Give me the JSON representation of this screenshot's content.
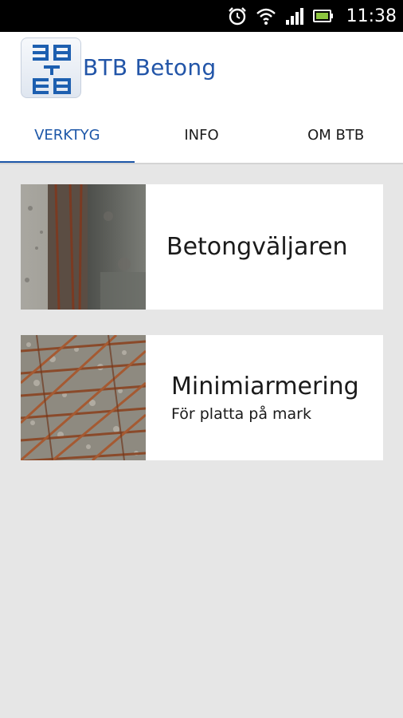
{
  "status_bar": {
    "time": "11:38",
    "icons": [
      "alarm-icon",
      "wifi-icon",
      "signal-icon",
      "battery-icon"
    ]
  },
  "app": {
    "title": "BTB Betong",
    "accent_color": "#1d57a8"
  },
  "tabs": [
    {
      "label": "VERKTYG",
      "active": true
    },
    {
      "label": "INFO",
      "active": false
    },
    {
      "label": "OM BTB",
      "active": false
    }
  ],
  "cards": [
    {
      "title": "Betongväljaren",
      "subtitle": ""
    },
    {
      "title": "Minimiarmering",
      "subtitle": "För platta på mark"
    }
  ]
}
